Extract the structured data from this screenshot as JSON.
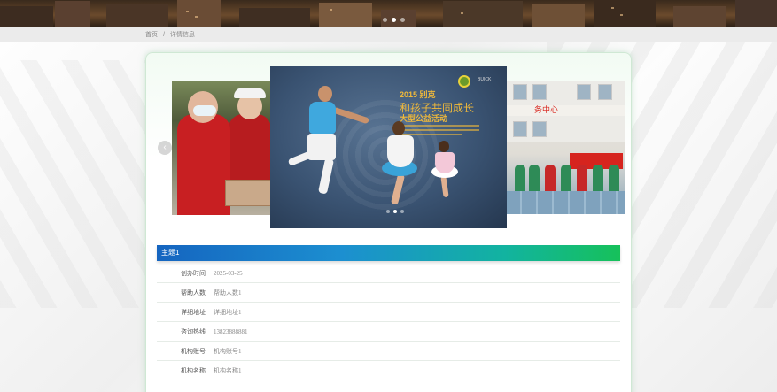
{
  "banner": {
    "dots": 3,
    "active_dot": 1
  },
  "breadcrumb": {
    "home": "首页",
    "separator": "/",
    "current": "详情信息"
  },
  "carousel": {
    "dots": 3,
    "active_dot": 1,
    "prev_label": "‹"
  },
  "poster": {
    "line1": "2015 别克",
    "line2": "和孩子共同成长",
    "line3": "大型公益活动"
  },
  "right_image": {
    "sign_text": "务中心"
  },
  "section": {
    "title": "主题1"
  },
  "details": [
    {
      "label": "创办时间",
      "value": "2025-03-25"
    },
    {
      "label": "帮助人数",
      "value": "帮助人数1"
    },
    {
      "label": "详细地址",
      "value": "详细地址1"
    },
    {
      "label": "咨询热线",
      "value": "13823888881"
    },
    {
      "label": "机构账号",
      "value": "机构账号1"
    },
    {
      "label": "机构名称",
      "value": "机构名称1"
    }
  ],
  "colors": {
    "title_bar_start": "#1565c0",
    "title_bar_end": "#16c15a",
    "card_border": "#cfe8d4"
  }
}
